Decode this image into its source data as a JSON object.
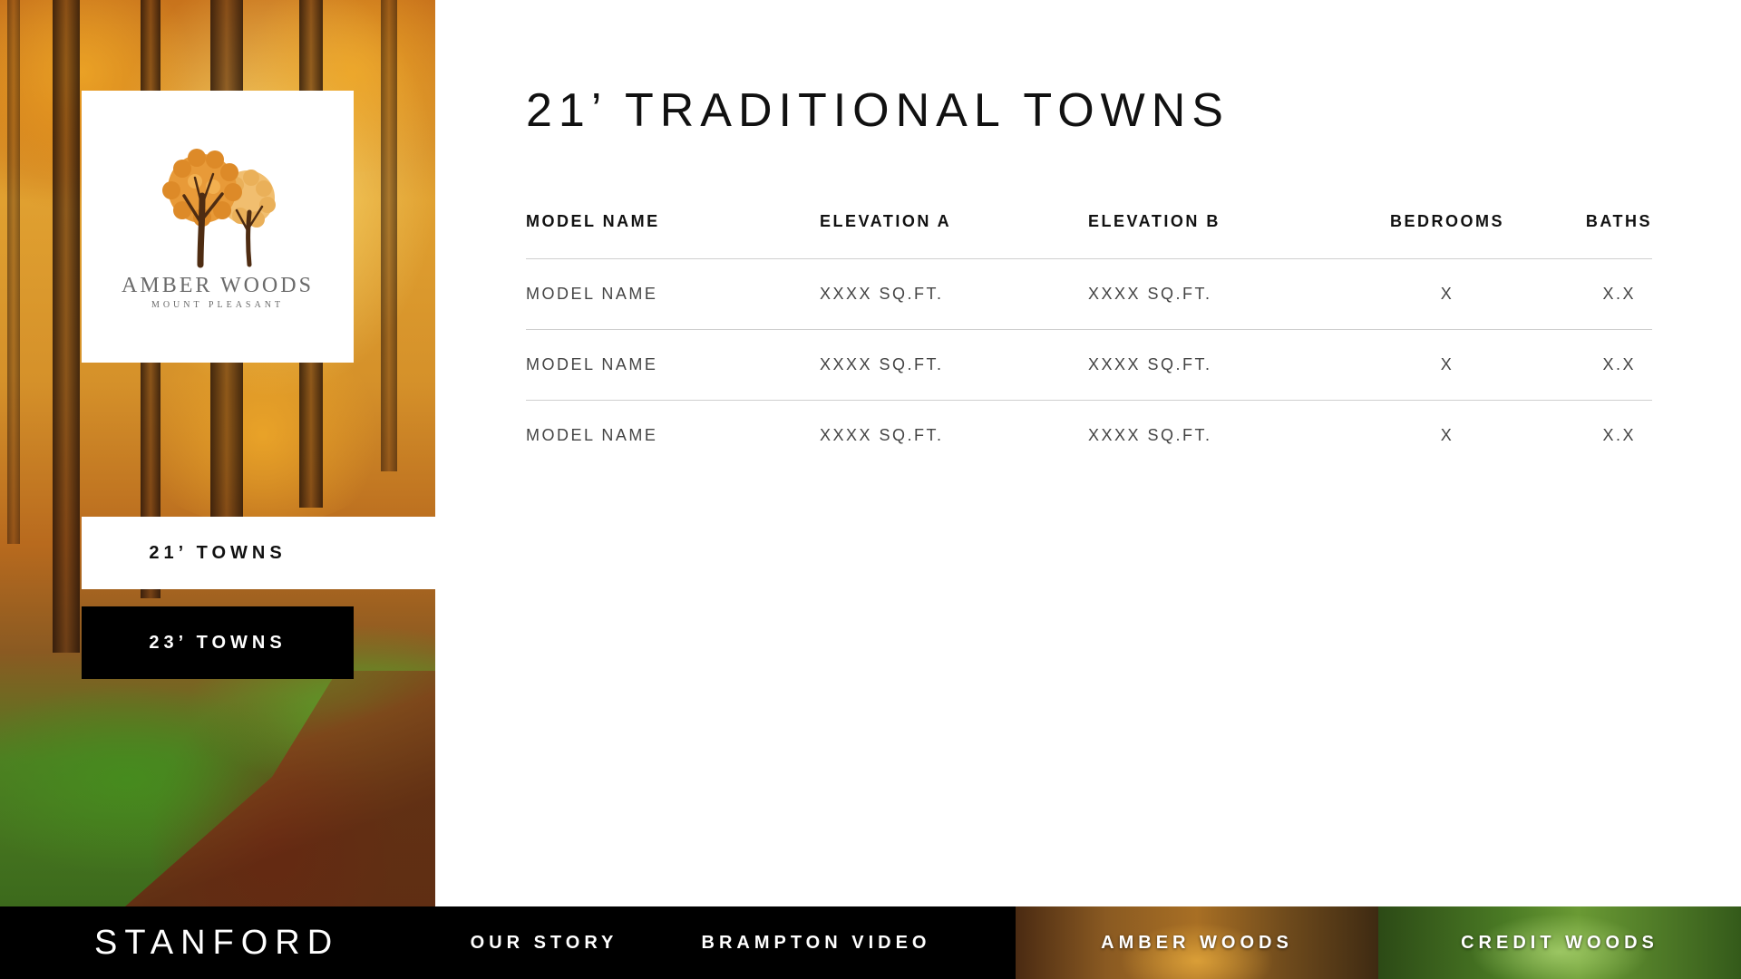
{
  "logo": {
    "title": "AMBER WOODS",
    "subtitle": "MOUNT PLEASANT"
  },
  "tabs": [
    {
      "label": "21’ TOWNS",
      "active": true
    },
    {
      "label": "23’ TOWNS",
      "active": false
    }
  ],
  "page_title": "21’ TRADITIONAL TOWNS",
  "table": {
    "headers": [
      "MODEL NAME",
      "ELEVATION A",
      "ELEVATION B",
      "BEDROOMS",
      "BATHS"
    ],
    "rows": [
      [
        "MODEL NAME",
        "XXXX SQ.FT.",
        "XXXX SQ.FT.",
        "X",
        "X.X"
      ],
      [
        "MODEL NAME",
        "XXXX SQ.FT.",
        "XXXX SQ.FT.",
        "X",
        "X.X"
      ],
      [
        "MODEL NAME",
        "XXXX SQ.FT.",
        "XXXX SQ.FT.",
        "X",
        "X.X"
      ]
    ]
  },
  "footer": {
    "brand": "STANFORD",
    "nav": [
      "OUR STORY",
      "BRAMPTON VIDEO",
      "AMBER WOODS",
      "CREDIT WOODS"
    ]
  },
  "colors": {
    "tab_active_bg": "#ffffff",
    "tab_inactive_bg": "#000000",
    "footer_bg": "#000000",
    "logo_orange": "#e0902a",
    "logo_brown": "#5a3418"
  }
}
